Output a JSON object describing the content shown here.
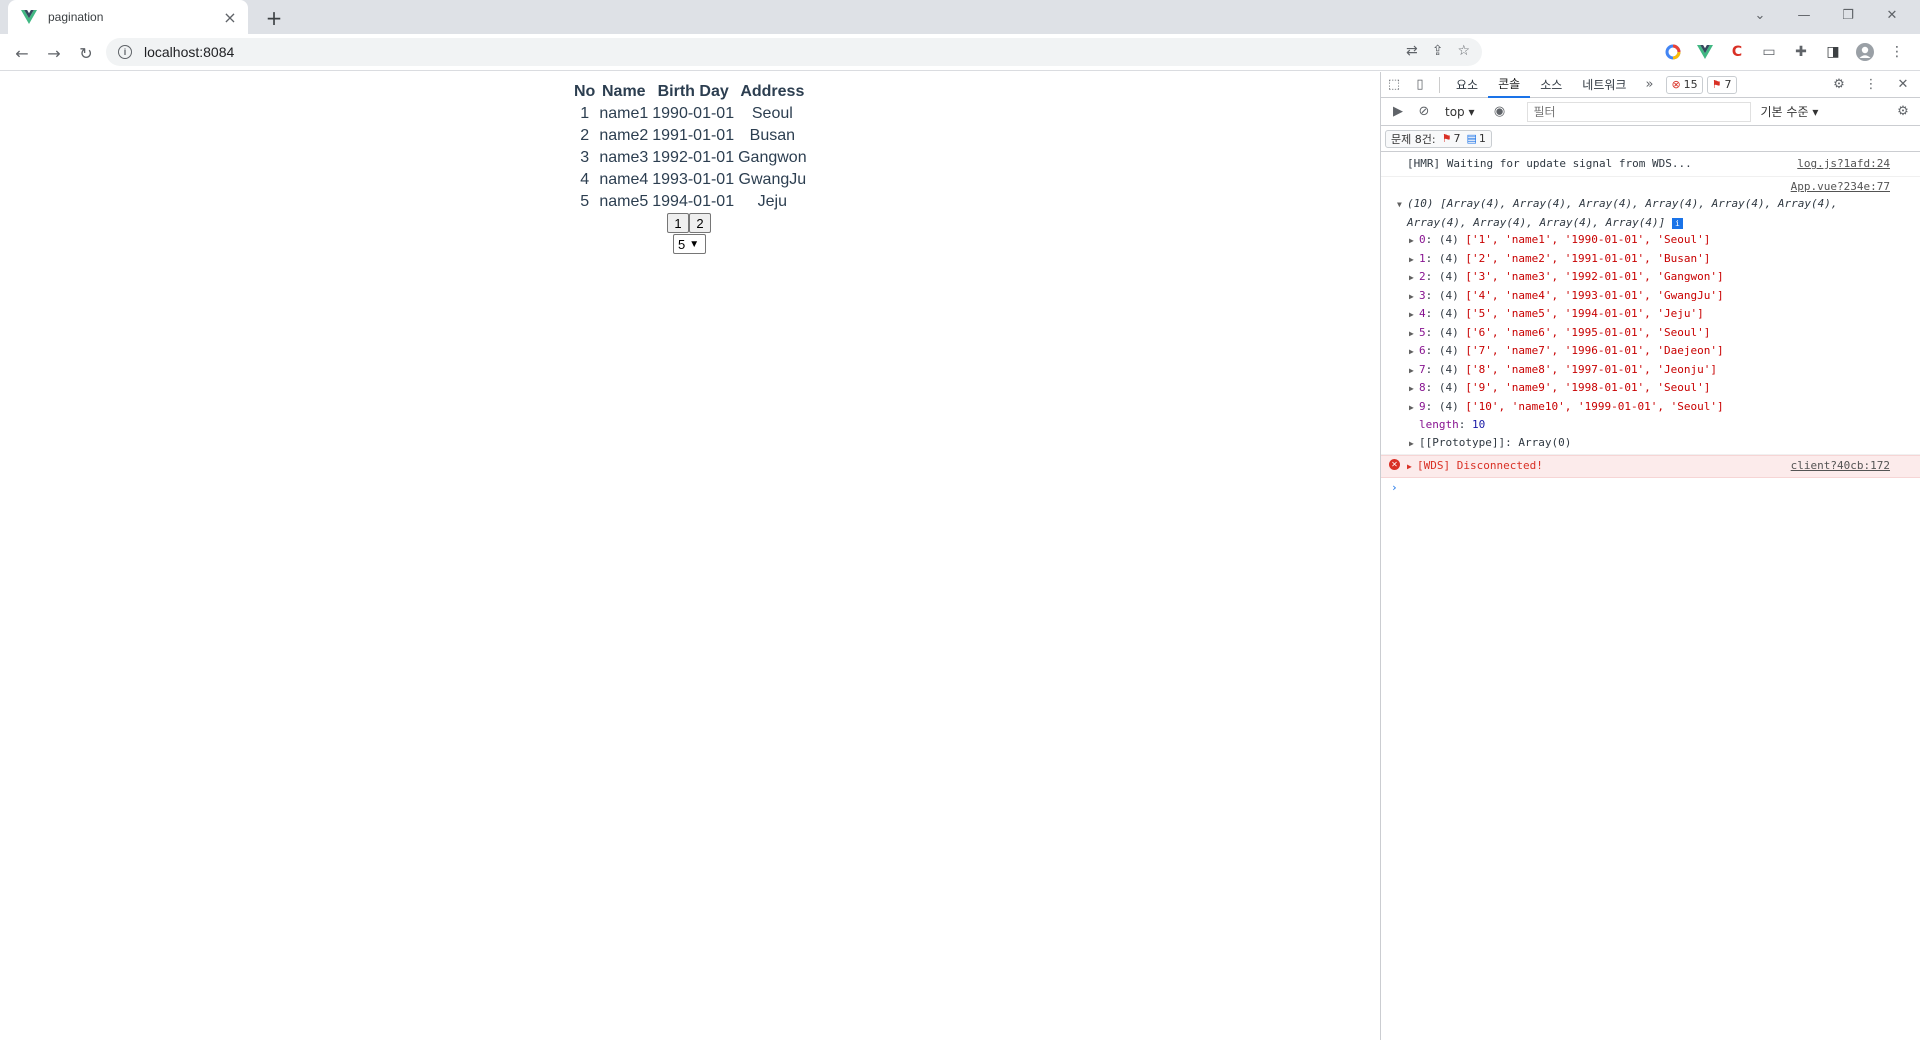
{
  "browser": {
    "tab_title": "pagination",
    "url": "localhost:8084",
    "accent": "#1a73e8"
  },
  "table": {
    "headers": [
      "No",
      "Name",
      "Birth Day",
      "Address"
    ],
    "rows": [
      [
        "1",
        "name1",
        "1990-01-01",
        "Seoul"
      ],
      [
        "2",
        "name2",
        "1991-01-01",
        "Busan"
      ],
      [
        "3",
        "name3",
        "1992-01-01",
        "Gangwon"
      ],
      [
        "4",
        "name4",
        "1993-01-01",
        "GwangJu"
      ],
      [
        "5",
        "name5",
        "1994-01-01",
        "Jeju"
      ]
    ]
  },
  "pager": {
    "pages": [
      "1",
      "2"
    ],
    "page_size": "5"
  },
  "devtools": {
    "tabs": [
      "요소",
      "콘솔",
      "소스",
      "네트워크"
    ],
    "active_tab": "콘솔",
    "error_count": "15",
    "warning_count": "7",
    "context": "top",
    "filter_placeholder": "필터",
    "level": "기본 수준",
    "issues_label": "문제 8건:",
    "issues_errors": "7",
    "issues_info": "1",
    "hmr_message": "[HMR] Waiting for update signal from WDS...",
    "hmr_source": "log.js?1afd:24",
    "array_source": "App.vue?234e:77",
    "array_summary_line1": "(10) [Array(4), Array(4), Array(4), Array(4), Array(4), Array(4),",
    "array_summary_line2": "Array(4), Array(4), Array(4), Array(4)]",
    "array_items": [
      {
        "idx": "0",
        "text": "['1', 'name1', '1990-01-01', 'Seoul']"
      },
      {
        "idx": "1",
        "text": "['2', 'name2', '1991-01-01', 'Busan']"
      },
      {
        "idx": "2",
        "text": "['3', 'name3', '1992-01-01', 'Gangwon']"
      },
      {
        "idx": "3",
        "text": "['4', 'name4', '1993-01-01', 'GwangJu']"
      },
      {
        "idx": "4",
        "text": "['5', 'name5', '1994-01-01', 'Jeju']"
      },
      {
        "idx": "5",
        "text": "['6', 'name6', '1995-01-01', 'Seoul']"
      },
      {
        "idx": "6",
        "text": "['7', 'name7', '1996-01-01', 'Daejeon']"
      },
      {
        "idx": "7",
        "text": "['8', 'name8', '1997-01-01', 'Jeonju']"
      },
      {
        "idx": "8",
        "text": "['9', 'name9', '1998-01-01', 'Seoul']"
      },
      {
        "idx": "9",
        "text": "['10', 'name10', '1999-01-01', 'Seoul']"
      }
    ],
    "length_label": "length",
    "length_value": "10",
    "prototype_label": "[[Prototype]]: Array(0)",
    "error_message": "[WDS] Disconnected!",
    "error_source": "client?40cb:172"
  }
}
